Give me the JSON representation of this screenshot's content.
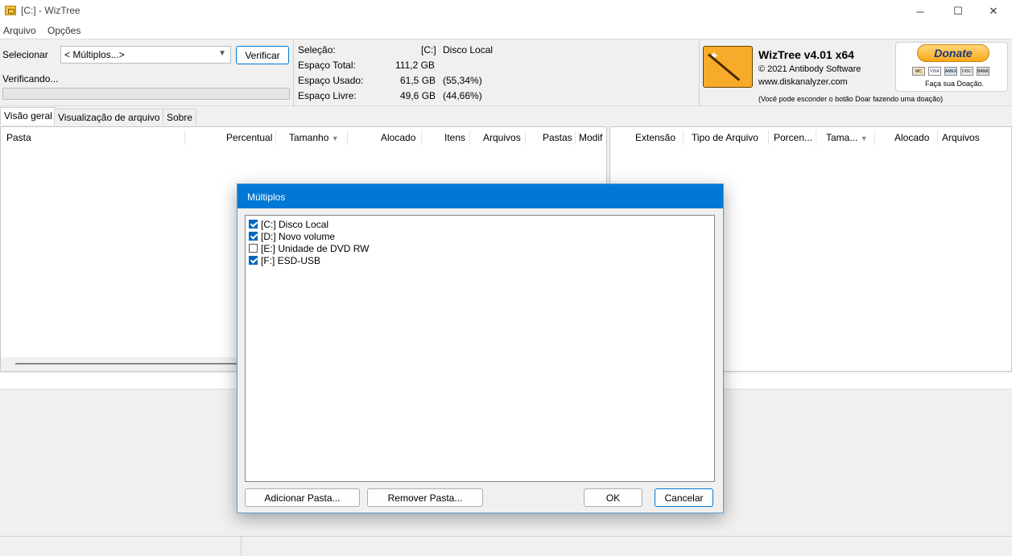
{
  "window": {
    "title": "[C:]  - WizTree",
    "min": "─",
    "max": "☐",
    "close": "✕"
  },
  "menu": [
    "Arquivo",
    "Opções"
  ],
  "toolbar": {
    "select_label": "Selecionar",
    "select_value": "< Múltiplos...>",
    "verify_button": "Verificar",
    "status": "Verificando...",
    "progress": 0
  },
  "info": {
    "selection_label": "Seleção:",
    "selection_drive": "[C:]",
    "selection_name": "Disco Local",
    "total_label": "Espaço Total:",
    "total_value": "111,2 GB",
    "used_label": "Espaço Usado:",
    "used_value": "61,5 GB",
    "used_pct": "(55,34%)",
    "free_label": "Espaço Livre:",
    "free_value": "49,6 GB",
    "free_pct": "(44,66%)"
  },
  "about": {
    "product": "WizTree v4.01 x64",
    "copyright": "© 2021 Antibody Software",
    "website": "www.diskanalyzer.com",
    "hide_note": "(Você pode esconder o botão Doar fazendo uma doação)",
    "donate_label": "Donate",
    "donate_caption": "Faça sua Doação.",
    "cards": [
      "MC",
      "VISA",
      "AMEX",
      "DISC",
      "BANK"
    ]
  },
  "tabs": [
    "Visão geral",
    "Visualização de arquivo",
    "Sobre"
  ],
  "left_columns": [
    "Pasta",
    "Percentual",
    "Tamanho",
    "Alocado",
    "Itens",
    "Arquivos",
    "Pastas",
    "Modif"
  ],
  "right_columns": [
    "Extensão",
    "Tipo de Arquivo",
    "Porcen...",
    "Tama...",
    "Alocado",
    "Arquivos"
  ],
  "dialog": {
    "title": "Múltiplos",
    "drives": [
      {
        "label": "[C:] Disco Local",
        "checked": true
      },
      {
        "label": "[D:] Novo volume",
        "checked": true
      },
      {
        "label": "[E:] Unidade de DVD RW",
        "checked": false
      },
      {
        "label": "[F:] ESD-USB",
        "checked": true
      }
    ],
    "add_button": "Adicionar Pasta...",
    "remove_button": "Remover Pasta...",
    "ok_button": "OK",
    "cancel_button": "Cancelar"
  }
}
